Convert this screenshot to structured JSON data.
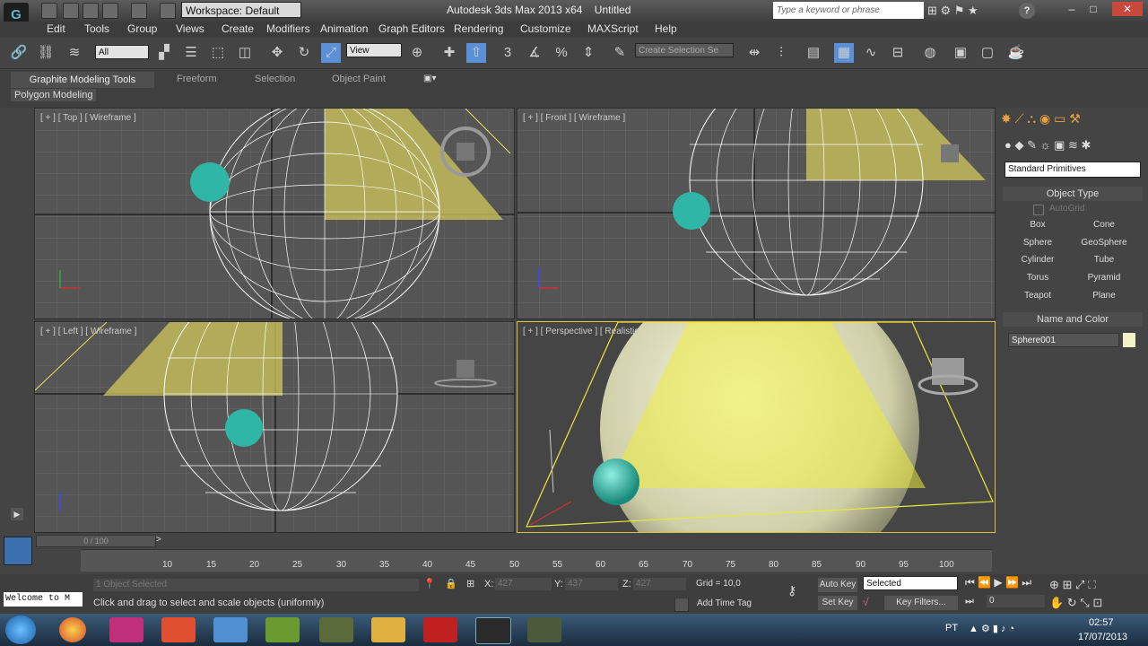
{
  "titlebar": {
    "workspace": "Workspace: Default",
    "app_title": "Autodesk 3ds Max  2013 x64",
    "document": "Untitled",
    "search_placeholder": "Type a keyword or phrase",
    "minimize": "–",
    "maximize": "□",
    "close": "✕"
  },
  "menus": [
    "Edit",
    "Tools",
    "Group",
    "Views",
    "Create",
    "Modifiers",
    "Animation",
    "Graph Editors",
    "Rendering",
    "Customize",
    "MAXScript",
    "Help"
  ],
  "toolbar": {
    "filter_value": "All",
    "ref_coord": "View",
    "selection_set_placeholder": "Create Selection Se",
    "snap_label": "3"
  },
  "ribbon": {
    "tabs": [
      "Graphite Modeling Tools",
      "Freeform",
      "Selection",
      "Object Paint"
    ],
    "subpanel": "Polygon Modeling"
  },
  "viewports": {
    "top": "[ + ] [ Top ] [ Wireframe ]",
    "front": "[ + ] [ Front ] [ Wireframe ]",
    "left": "[ + ] [ Left ] [ Wireframe ]",
    "perspective": "[ + ] [ Perspective ] [ Realistic"
  },
  "command_panel": {
    "category": "Standard Primitives",
    "object_type_header": "Object Type",
    "autogrid": "AutoGrid",
    "primitives": [
      "Box",
      "Cone",
      "Sphere",
      "GeoSphere",
      "Cylinder",
      "Tube",
      "Torus",
      "Pyramid",
      "Teapot",
      "Plane"
    ],
    "name_color_header": "Name and Color",
    "object_name": "Sphere001",
    "object_color": "#f2f2c8"
  },
  "timeline": {
    "frame_counter": "0 / 100",
    "ticks": [
      "10",
      "15",
      "20",
      "25",
      "30",
      "35",
      "40",
      "45",
      "50",
      "55",
      "60",
      "65",
      "70",
      "75",
      "80",
      "85",
      "90",
      "95",
      "100"
    ]
  },
  "status": {
    "selection": "1 Object Selected",
    "prompt": "Click and drag to select and scale objects (uniformly)",
    "x_label": "X:",
    "x_value": "427",
    "y_label": "Y:",
    "y_value": "437",
    "z_label": "Z:",
    "z_value": "427",
    "grid": "Grid = 10,0",
    "add_time_tag": "Add Time Tag",
    "auto_key": "Auto Key",
    "set_key": "Set Key",
    "key_mode": "Selected",
    "key_filters": "Key Filters...",
    "current_frame": "0",
    "maxscript": "Welcome to M"
  },
  "taskbar": {
    "language": "PT",
    "time": "02:57",
    "date": "17/07/2013"
  },
  "colors": {
    "wireframe_selected": "#f0f0a0",
    "teal_sphere": "#2fb6a6",
    "yellow_plane": "#d8d060"
  }
}
